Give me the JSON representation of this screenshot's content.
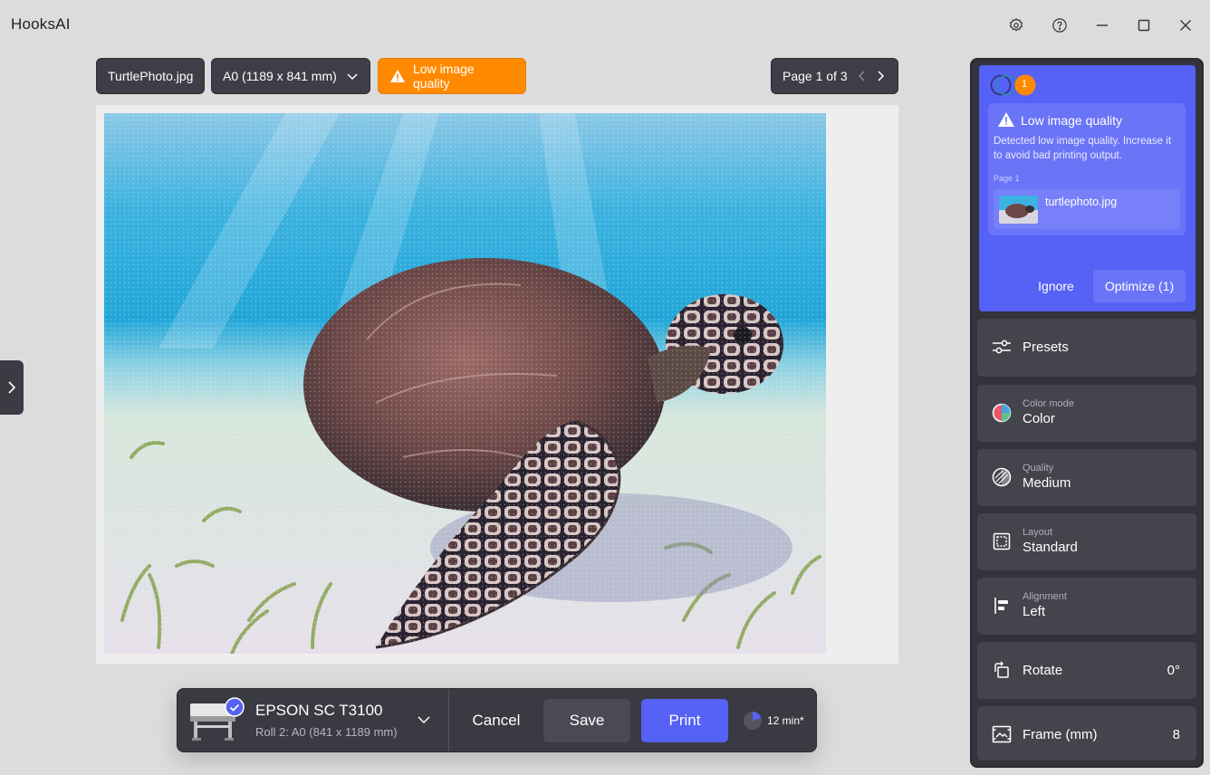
{
  "app": {
    "title": "HooksAI"
  },
  "toolbar": {
    "file_name": "TurtlePhoto.jpg",
    "paper_size": "A0 (1189 x 841 mm)",
    "warning": "Low image quality",
    "page_label": "Page 1 of 3"
  },
  "printbar": {
    "printer_name": "EPSON SC T3100",
    "printer_sub": "Roll 2: A0 (841 x 1189 mm)",
    "cancel_label": "Cancel",
    "save_label": "Save",
    "print_label": "Print",
    "eta": "12 min*"
  },
  "alert": {
    "badge_count": "1",
    "title": "Low image quality",
    "description": "Detected low image quality. Increase it to avoid bad printing output.",
    "page_label": "Page 1",
    "file_name": "turtlephoto.jpg",
    "ignore_label": "Ignore",
    "optimize_label": "Optimize (1)"
  },
  "settings": {
    "presets": {
      "label": "Presets"
    },
    "color_mode": {
      "label": "Color mode",
      "value": "Color"
    },
    "quality": {
      "label": "Quality",
      "value": "Medium"
    },
    "layout": {
      "label": "Layout",
      "value": "Standard"
    },
    "alignment": {
      "label": "Alignment",
      "value": "Left"
    },
    "rotate": {
      "label": "Rotate",
      "value": "0°"
    },
    "frame": {
      "label": "Frame (mm)",
      "value": "8"
    }
  },
  "colors": {
    "accent": "#5661f5",
    "warning": "#ff8a00",
    "panel": "#33333b",
    "background": "#dcdcdc"
  },
  "icons": [
    "gear-icon",
    "help-icon",
    "minimize-icon",
    "maximize-icon",
    "close-icon",
    "chevron-down-icon",
    "warning-icon",
    "chevron-left-icon",
    "chevron-right-icon",
    "check-icon",
    "sliders-icon",
    "color-wheel-icon",
    "quality-icon",
    "layout-icon",
    "align-left-icon",
    "rotate-icon",
    "frame-icon"
  ]
}
